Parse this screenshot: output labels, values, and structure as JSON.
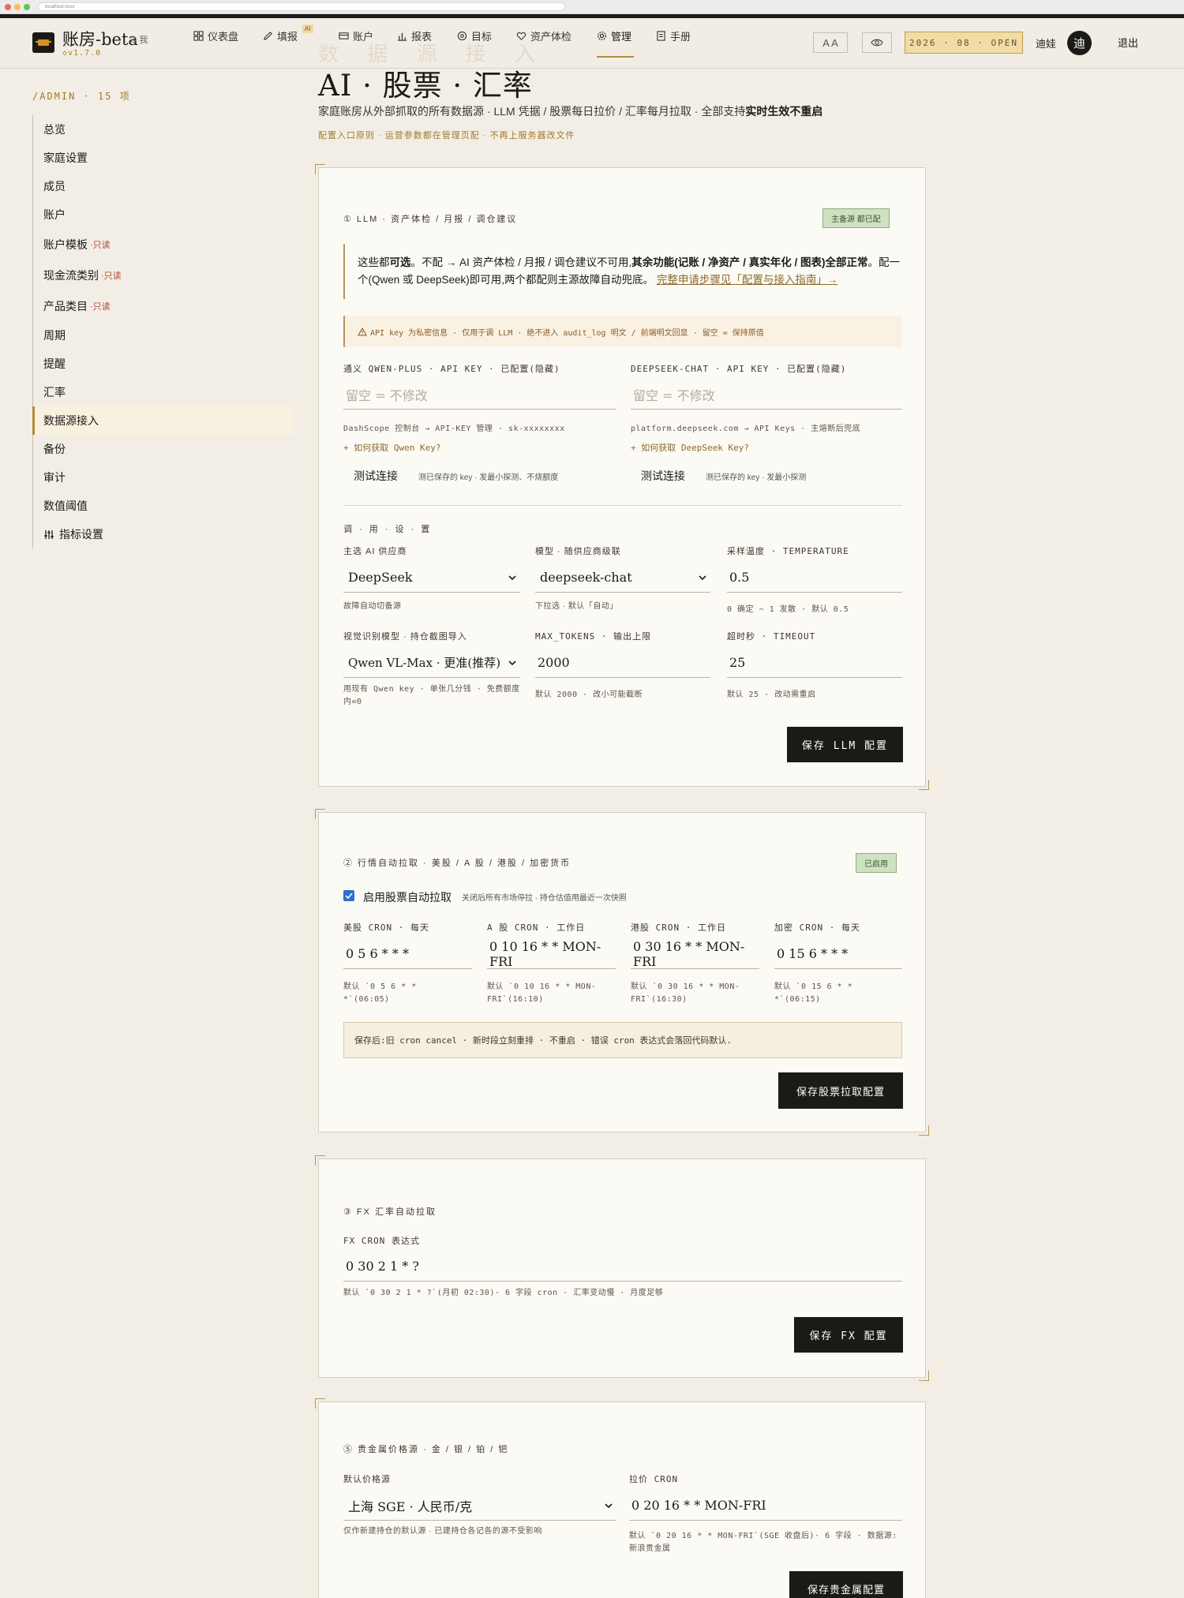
{
  "browser": {
    "url": "localhost:xxxx"
  },
  "app": {
    "title": "账房-beta",
    "subtitle": "& 我",
    "version": "◇v1.7.0"
  },
  "nav": {
    "items": [
      "仪表盘",
      "填报",
      "账户",
      "报表",
      "目标",
      "资产体检",
      "管理",
      "手册"
    ],
    "ai_badge": "AI",
    "font_toggle": "A A",
    "date_badge": "2026 · 08 · OPEN",
    "user": "迪娃",
    "avatar": "迪",
    "logout": "退出"
  },
  "sidebar": {
    "heading": "/ADMIN · 15 项",
    "items": [
      {
        "label": "总览"
      },
      {
        "label": "家庭设置"
      },
      {
        "label": "成员"
      },
      {
        "label": "账户"
      },
      {
        "label": "账户模板",
        "tag": "·只读"
      },
      {
        "label": "现金流类别",
        "tag": "·只读"
      },
      {
        "label": "产品类目",
        "tag": "·只读"
      },
      {
        "label": "周期"
      },
      {
        "label": "提醒"
      },
      {
        "label": "汇率"
      },
      {
        "label": "数据源接入"
      },
      {
        "label": "备份"
      },
      {
        "label": "审计"
      },
      {
        "label": "数值阈值"
      },
      {
        "label": "指标设置"
      }
    ]
  },
  "page": {
    "title": "AI · 股票 · 汇率",
    "ghost": "数 据 源 接 入",
    "desc": "家庭账房从外部抓取的所有数据源 · LLM 凭据 / 股票每日拉价 / 汇率每月拉取 · 全部支持",
    "desc_bold": "实时生效不重启",
    "note": "配置入口原则 · 运营参数都在管理页配 · 不再上服务器改文件"
  },
  "llm": {
    "title": "① LLM · 资产体检 / 月报 / 调仓建议",
    "badge": "主备源 都已配",
    "info_1": "这些都",
    "info_2": "可选",
    "info_3": "。不配 → AI 资产体检 / 月报 / 调仓建议不可用,",
    "info_4": "其余功能(记账 / 净资产 / 真实年化 / 图表)全部正常",
    "info_5": "。配一个(Qwen 或 DeepSeek)即可用,两个都配则主源故障自动兜底。",
    "info_link": "完整申请步骤见「配置与接入指南」→",
    "warn": "API key 为私密信息 · 仅用于调 LLM · 绝不进入 audit_log 明文 / 前端明文回显 · 留空 = 保持原值",
    "qwen_label": "通义 QWEN-PLUS · API KEY · 已配置(隐藏)",
    "qwen_placeholder": "留空 = 不修改",
    "qwen_hint": "DashScope 控制台 → API-KEY 管理 · sk-xxxxxxxx",
    "qwen_link": "+ 如何获取 Qwen Key?",
    "qwen_test": "测试连接",
    "qwen_test_hint": "测已保存的 key · 发最小探测、不烧额度",
    "ds_label": "DEEPSEEK-CHAT · API KEY · 已配置(隐藏)",
    "ds_placeholder": "留空 = 不修改",
    "ds_hint": "platform.deepseek.com → API Keys · 主熔断后兜底",
    "ds_link": "+ 如何获取 DeepSeek Key?",
    "ds_test": "测试连接",
    "ds_test_hint": "测已保存的 key · 发最小探测",
    "settings_title": "调 · 用 · 设 · 置",
    "provider_label": "主选 AI 供应商",
    "provider_value": "DeepSeek",
    "provider_hint": "故障自动切备源",
    "model_label": "模型 · 随供应商级联",
    "model_value": "deepseek-chat",
    "model_hint": "下拉选 · 默认「自动」",
    "temp_label": "采样温度 · TEMPERATURE",
    "temp_value": "0.5",
    "temp_hint": "0 确定 ~ 1 发散 · 默认 0.5",
    "vision_label": "视觉识别模型 · 持仓截图导入",
    "vision_value": "Qwen VL-Max · 更准(推荐)",
    "vision_hint": "用现有 Qwen key · 单张几分钱 · 免费额度内=0",
    "tokens_label": "MAX_TOKENS · 输出上限",
    "tokens_value": "2000",
    "tokens_hint": "默认 2000 · 改小可能截断",
    "timeout_label": "超时秒 · TIMEOUT",
    "timeout_value": "25",
    "timeout_hint": "默认 25 · 改动需重启",
    "save": "保存 LLM 配置"
  },
  "stock": {
    "title": "② 行情自动拉取 · 美股 / A 股 / 港股 / 加密货币",
    "badge": "已启用",
    "enable_label": "启用股票自动拉取",
    "enable_hint": "关闭后所有市场停拉 · 持仓估值用最近一次快照",
    "us_label": "美股 CRON · 每天",
    "us_value": "0 5 6 * * *",
    "us_hint": "默认 `0 5 6 * * *`(06:05)",
    "a_label": "A 股 CRON · 工作日",
    "a_value": "0 10 16 * * MON-FRI",
    "a_hint": "默认 `0 10 16 * * MON-FRI`(16:10)",
    "hk_label": "港股 CRON · 工作日",
    "hk_value": "0 30 16 * * MON-FRI",
    "hk_hint": "默认 `0 30 16 * * MON-FRI`(16:30)",
    "crypto_label": "加密 CRON · 每天",
    "crypto_value": "0 15 6 * * *",
    "crypto_hint": "默认 `0 15 6 * * *`(06:15)",
    "notice": "保存后:旧 cron cancel · 新时段立刻重排 · 不重启 · 错误 cron 表达式会落回代码默认.",
    "save": "保存股票拉取配置"
  },
  "fx": {
    "title": "③ FX 汇率自动拉取",
    "label": "FX CRON 表达式",
    "value": "0 30 2 1 * ?",
    "hint": "默认 `0 30 2 1 * ?`(月初 02:30)· 6 字段 cron · 汇率变动慢 · 月度足够",
    "save": "保存 FX 配置"
  },
  "metal": {
    "title": "⑤ 贵金属价格源 · 金 / 银 / 铂 / 钯",
    "source_label": "默认价格源",
    "source_value": "上海 SGE · 人民币/克",
    "source_hint": "仅作新建持仓的默认源 · 已建持仓各记各的源不受影响",
    "cron_label": "拉价 CRON",
    "cron_value": "0 20 16 * * MON-FRI",
    "cron_hint": "默认 `0 20 16 * * MON-FRI`(SGE 收盘后)· 6 字段 · 数据源:新浪贵金属",
    "save": "保存贵金属配置"
  },
  "colors": {
    "accent": "#1c1a17",
    "gold": "#b28a3a",
    "ok": "#cfe1c3",
    "bg": "#f2eee6",
    "card": "#fcfaf5"
  }
}
